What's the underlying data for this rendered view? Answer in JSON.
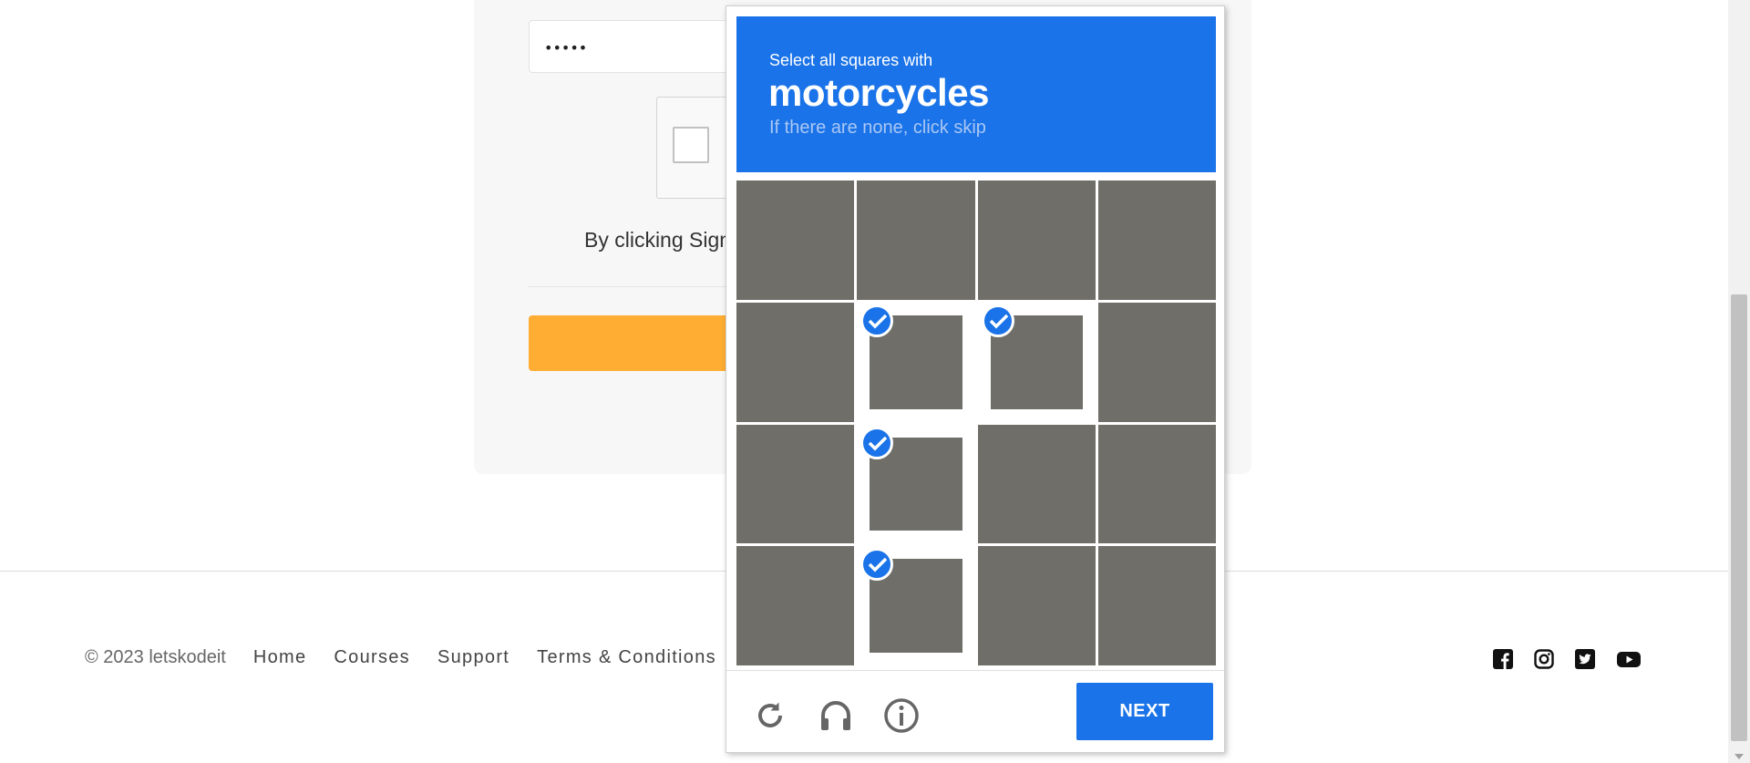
{
  "form": {
    "password_value": "•••••",
    "terms_text": "By clicking Sign"
  },
  "footer": {
    "copyright": "© 2023 letskodeit",
    "links": [
      "Home",
      "Courses",
      "Support",
      "Terms & Conditions"
    ],
    "social_icons": [
      "facebook-icon",
      "instagram-icon",
      "twitter-icon",
      "youtube-icon"
    ]
  },
  "captcha": {
    "prompt_line1": "Select all squares with",
    "target_object": "motorcycles",
    "prompt_skip": "If there are none, click skip",
    "grid_size": "4x4",
    "selected_tiles": [
      5,
      6,
      9,
      13
    ],
    "controls": [
      "reload-icon",
      "audio-icon",
      "info-icon"
    ],
    "next_label": "NEXT",
    "accent_color": "#1a73e8"
  },
  "colors": {
    "signup_button": "#ffad33",
    "prompt_background": "#1a73e8"
  }
}
